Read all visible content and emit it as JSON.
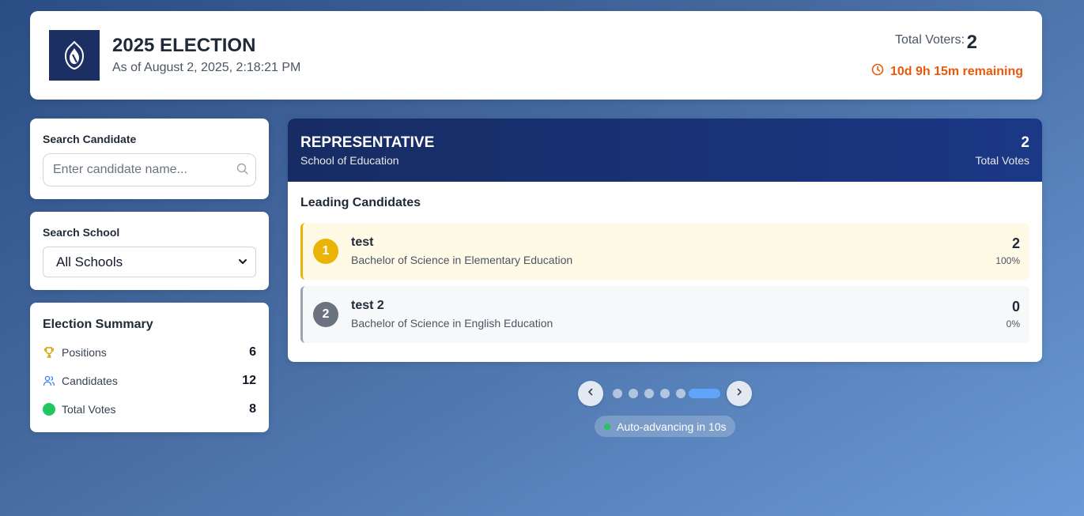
{
  "header": {
    "title": "2025 ELECTION",
    "as_of": "As of August 2, 2025, 2:18:21 PM",
    "total_voters_label": "Total Voters:",
    "total_voters": "2",
    "remaining": "10d 9h 15m remaining"
  },
  "search_candidate": {
    "label": "Search Candidate",
    "placeholder": "Enter candidate name...",
    "value": ""
  },
  "search_school": {
    "label": "Search School",
    "selected": "All Schools"
  },
  "summary": {
    "title": "Election Summary",
    "rows": [
      {
        "label": "Positions",
        "value": "6",
        "icon": "trophy-icon"
      },
      {
        "label": "Candidates",
        "value": "12",
        "icon": "users-icon"
      },
      {
        "label": "Total Votes",
        "value": "8",
        "icon": "green-dot-icon"
      }
    ]
  },
  "position": {
    "title": "REPRESENTATIVE",
    "school": "School of Education",
    "votes": "2",
    "votes_label": "Total Votes",
    "leading_label": "Leading Candidates",
    "candidates": [
      {
        "rank": "1",
        "name": "test",
        "program": "Bachelor of Science in Elementary Education",
        "votes": "2",
        "percent": "100%"
      },
      {
        "rank": "2",
        "name": "test 2",
        "program": "Bachelor of Science in English Education",
        "votes": "0",
        "percent": "0%"
      }
    ]
  },
  "carousel": {
    "slide_count": 6,
    "active_index": 5,
    "auto_text": "Auto-advancing in 10s"
  },
  "colors": {
    "accent_orange": "#ea580c",
    "gold": "#eab308",
    "navy": "#172c63",
    "active_dot": "#60a5fa",
    "live_green": "#22c55e"
  }
}
